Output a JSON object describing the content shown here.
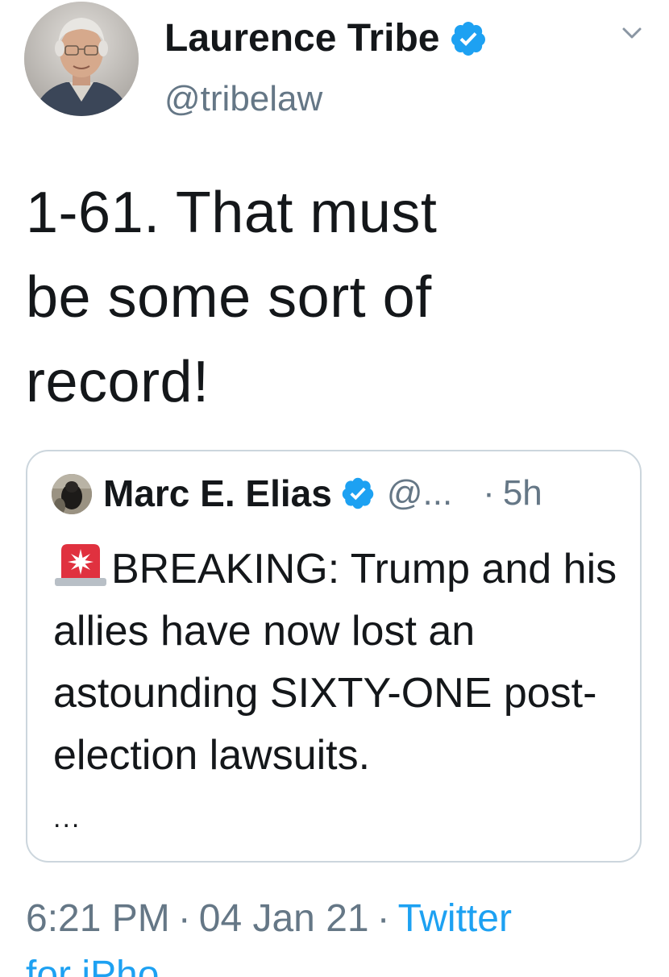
{
  "author": {
    "name": "Laurence Tribe",
    "handle": "@tribelaw",
    "verified": true
  },
  "tweet": {
    "text": "1-61. That must\nbe some sort of\nrecord!"
  },
  "quoted_tweet": {
    "name": "Marc E. Elias",
    "handle": "@...",
    "time_separator": "·",
    "time": "5h",
    "verified": true,
    "siren_icon": "rotating-light-icon",
    "text": "BREAKING: Trump and his allies have now lost an astounding SIXTY-ONE post-election lawsuits.",
    "ellipsis": "..."
  },
  "meta": {
    "time": "6:21 PM",
    "separator": "·",
    "date": "04 Jan 21",
    "source": "Twitter"
  },
  "colors": {
    "verified_blue": "#1da1f2",
    "secondary_text": "#657786",
    "border": "#ccd6dd"
  }
}
